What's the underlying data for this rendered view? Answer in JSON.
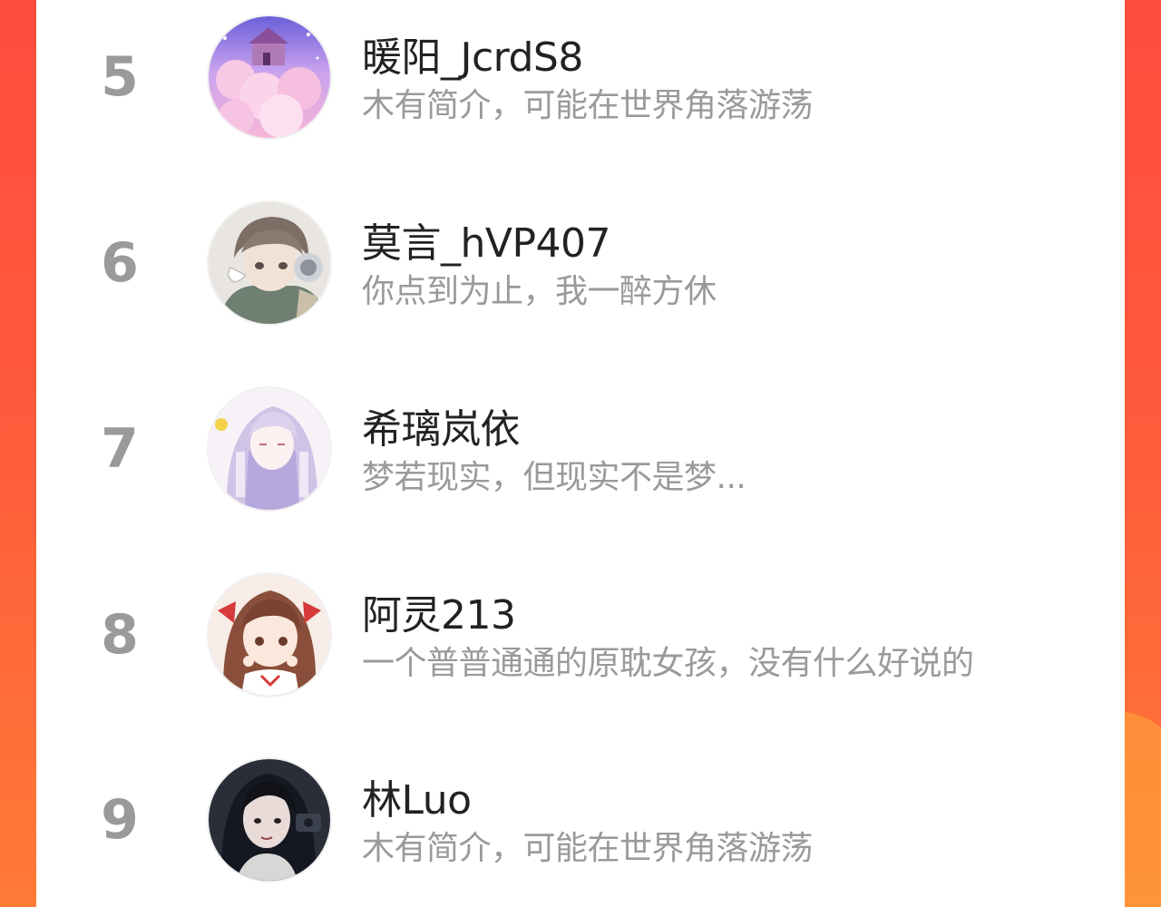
{
  "ranking": {
    "entries": [
      {
        "rank": "5",
        "name": "暖阳_JcrdS8",
        "bio": "木有简介，可能在世界角落游荡",
        "avatar": "avatar-pink-cloud-castle"
      },
      {
        "rank": "6",
        "name": "莫言_hVP407",
        "bio": "你点到为止，我一醉方休",
        "avatar": "avatar-anime-boy-headphones"
      },
      {
        "rank": "7",
        "name": "希璃岚依",
        "bio": "梦若现实，但现实不是梦...",
        "avatar": "avatar-anime-lavender-girl"
      },
      {
        "rank": "8",
        "name": "阿灵213",
        "bio": "一个普普通通的原耽女孩，没有什么好说的",
        "avatar": "avatar-anime-shrine-maiden"
      },
      {
        "rank": "9",
        "name": "林Luo",
        "bio": "木有简介，可能在世界角落游荡",
        "avatar": "avatar-dark-haired-girl"
      }
    ]
  },
  "colors": {
    "background_gradient_top": "#ff4d3f",
    "background_gradient_bottom": "#ff7a36",
    "panel": "#ffffff",
    "rank_text": "#9a9a9a",
    "name_text": "#222222",
    "bio_text": "#9a9a9a"
  }
}
